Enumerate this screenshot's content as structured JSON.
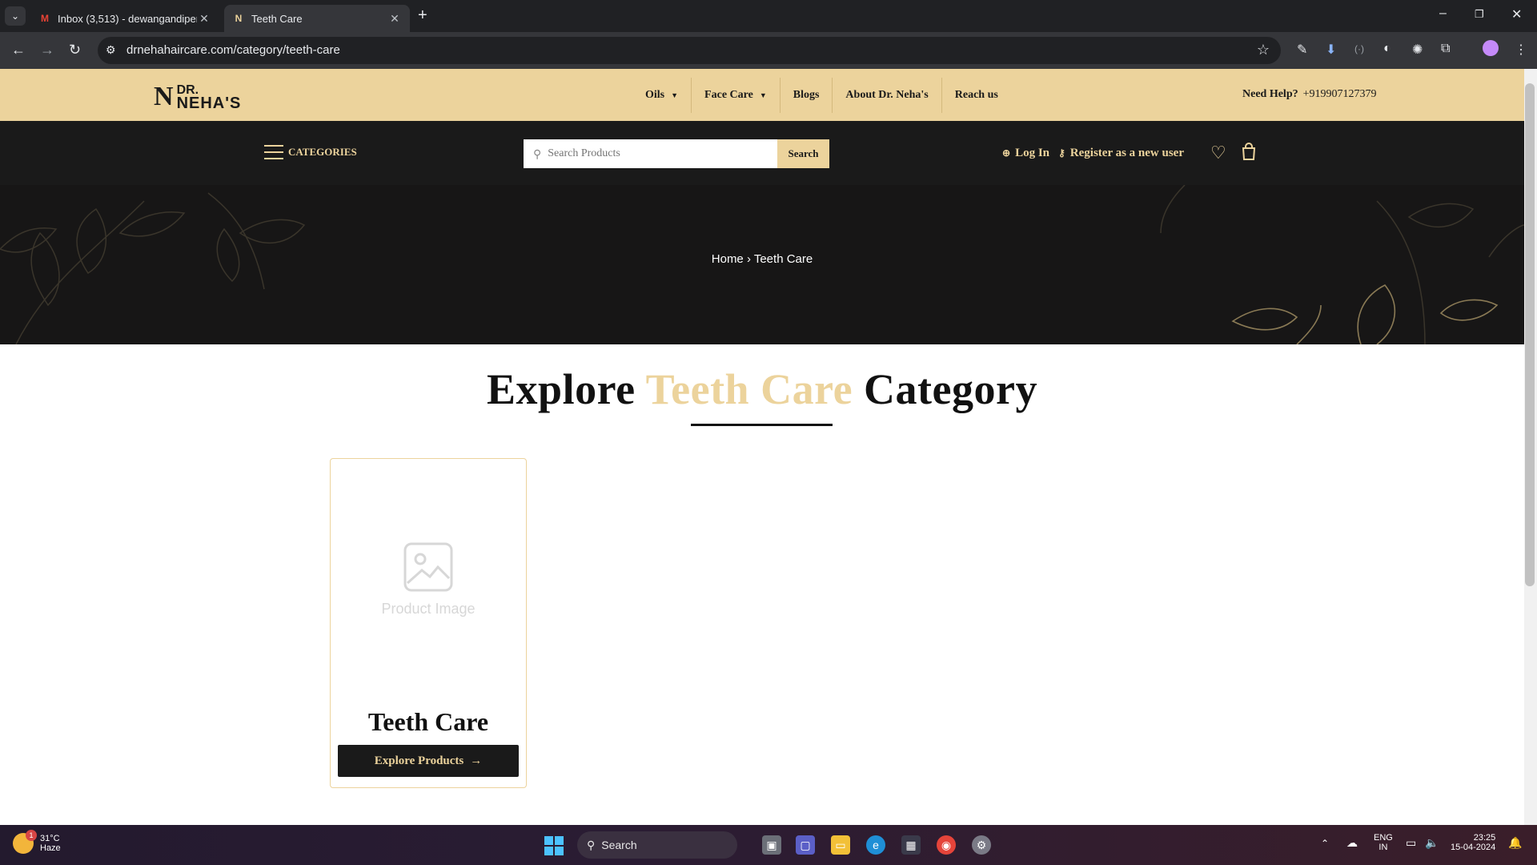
{
  "browser": {
    "tabs": [
      {
        "title": "Inbox (3,513) - dewangandipen",
        "favicon": "gmail-icon"
      },
      {
        "title": "Teeth Care",
        "favicon": "site-favicon"
      }
    ],
    "url": "drnehahaircare.com/category/teeth-care"
  },
  "site": {
    "logo": {
      "mark": "N",
      "line1": "DR.",
      "line2": "NEHA'S"
    },
    "menu": [
      {
        "label": "Oils",
        "dropdown": true
      },
      {
        "label": "Face Care",
        "dropdown": true
      },
      {
        "label": "Blogs",
        "dropdown": false
      },
      {
        "label": "About Dr. Neha's",
        "dropdown": false
      },
      {
        "label": "Reach us",
        "dropdown": false
      }
    ],
    "help": {
      "label": "Need Help?",
      "phone": "+919907127379"
    },
    "categories_label": "CATEGORIES",
    "search": {
      "placeholder": "Search Products",
      "button": "Search"
    },
    "login": "Log In",
    "register": "Register as a new user"
  },
  "hero": {
    "breadcrumb": "Home › Teeth Care"
  },
  "main": {
    "headline": {
      "part1": "Explore",
      "accent": "Teeth Care",
      "part2": "Category"
    },
    "card": {
      "image_placeholder": "Product Image",
      "title": "Teeth Care",
      "button": "Explore Products"
    }
  },
  "taskbar": {
    "weather": {
      "temp": "31°C",
      "condition": "Haze",
      "badge": "1"
    },
    "search": "Search",
    "lang": {
      "line1": "ENG",
      "line2": "IN"
    },
    "time": "23:25",
    "date": "15-04-2024"
  },
  "colors": {
    "gold": "#ecd39c",
    "dark": "#1a1a1a"
  }
}
